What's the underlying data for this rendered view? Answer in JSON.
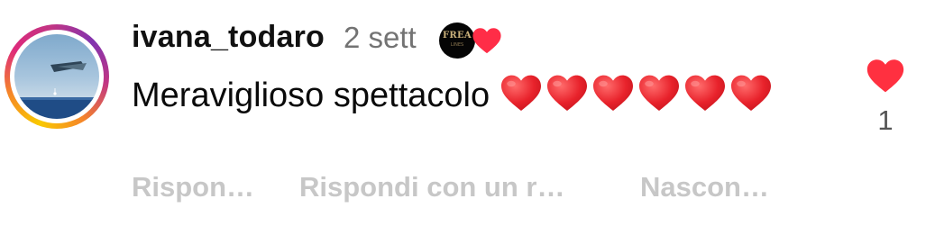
{
  "comment": {
    "author": "ivana_todaro",
    "time": "2 sett",
    "badge": {
      "label": "FREA",
      "sub_label": "LINES"
    },
    "text": "Meraviglioso spettacolo",
    "emoji": [
      "red-heart",
      "red-heart",
      "red-heart",
      "red-heart",
      "red-heart",
      "red-heart"
    ],
    "actions": {
      "reply": "Rispon…",
      "reply_with": "Rispondi con un r…",
      "hide": "Nascon…"
    },
    "likes": {
      "count": "1",
      "liked": true
    }
  },
  "colors": {
    "like_red": "#ff3040",
    "username": "#111111",
    "time": "#737373",
    "actions": "#c7c7c7",
    "like_count": "#555555"
  }
}
